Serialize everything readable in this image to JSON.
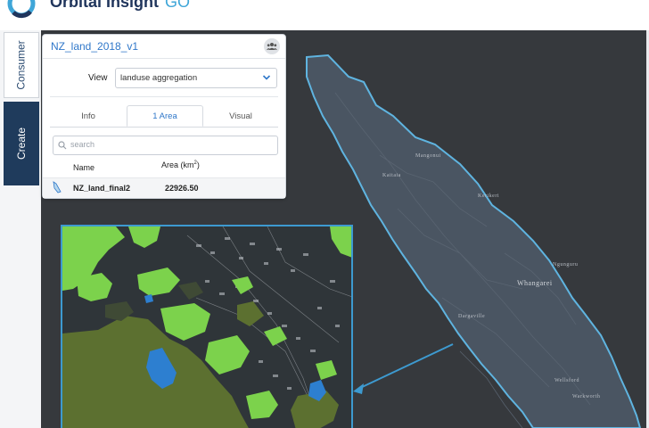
{
  "header": {
    "brand_name": "Orbital Insight",
    "brand_suffix": "GO",
    "logo_icon": "ring-logo-icon"
  },
  "sidebar": {
    "tabs": [
      {
        "label": "Consumer",
        "active": false
      },
      {
        "label": "Create",
        "active": true
      }
    ]
  },
  "panel": {
    "title": "NZ_land_2018_v1",
    "share_icon": "users-icon",
    "view_label": "View",
    "view_value": "landuse aggregation",
    "tabs": [
      {
        "label": "Info",
        "active": false
      },
      {
        "label": "1 Area",
        "active": true
      },
      {
        "label": "Visual",
        "active": false
      }
    ],
    "search_placeholder": "search",
    "table": {
      "col_name": "Name",
      "col_area": "Area (km",
      "col_area_sup": "2",
      "col_area_close": ")",
      "rows": [
        {
          "icon": "polygon-icon",
          "name": "NZ_land_final2",
          "area": "22926.50"
        }
      ]
    }
  },
  "map": {
    "place_labels": [
      "Mangonui",
      "Kaitaia",
      "Kerikeri",
      "Ngunguru",
      "Whangarei",
      "Dargaville",
      "Wellsford",
      "Warkworth"
    ],
    "colors": {
      "background": "#36393d",
      "land": "#4a5562",
      "outline": "#5fb4e0",
      "inset_border": "#3d9ad0",
      "vegetation": "#7cd24c",
      "park": "#5c7030",
      "water": "#2d7fd0"
    }
  }
}
